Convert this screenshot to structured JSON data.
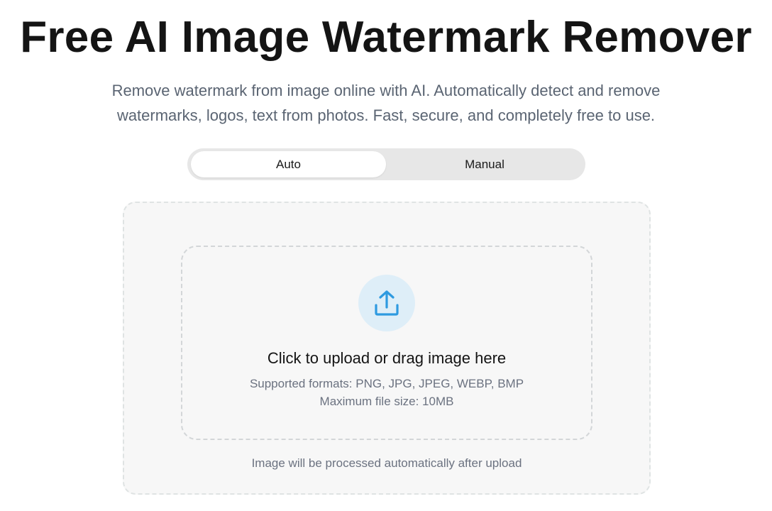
{
  "header": {
    "title": "Free AI Image Watermark Remover",
    "subtitle": "Remove watermark from image online with AI. Automatically detect and remove watermarks, logos, text from photos. Fast, secure, and completely free to use."
  },
  "mode_toggle": {
    "auto_label": "Auto",
    "manual_label": "Manual",
    "selected": "Auto"
  },
  "upload": {
    "icon": "upload-icon",
    "title": "Click to upload or drag image here",
    "formats": "Supported formats: PNG, JPG, JPEG, WEBP, BMP",
    "max_size": "Maximum file size: 10MB",
    "note": "Image will be processed automatically after upload"
  },
  "colors": {
    "accent": "#2e9ae0",
    "icon_bg": "#deeef8",
    "toggle_bg": "#e7e7e7",
    "panel_bg": "#f7f7f7",
    "muted_text": "#6b7280"
  }
}
